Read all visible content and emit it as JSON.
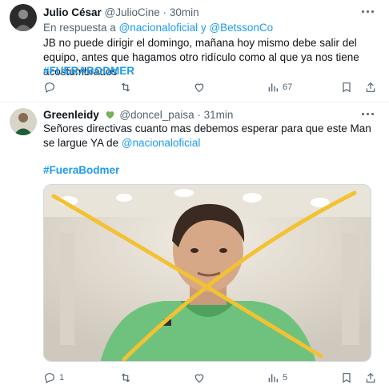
{
  "tweets": [
    {
      "author": "Julio César",
      "handle": "@JulioCine",
      "separator": "·",
      "time": "30min",
      "reply_prefix": "En respuesta a",
      "reply_to_1": "@nacionaloficial",
      "reply_joiner": "y",
      "reply_to_2": "@BetssonCo",
      "text": "JB no puede dirigir el domingo, mañana hoy mismo debe salir del equipo, antes que hagamos otro ridículo como al que ya nos tiene acostumbrados",
      "hashtag": "#FUERABODMER",
      "actions": {
        "reply": "",
        "retweet": "",
        "like": "",
        "views": "67"
      }
    },
    {
      "author": "Greenleidy",
      "handle": "@doncel_paisa",
      "separator": "·",
      "time": "31min",
      "text_before_mention": "Señores directivas cuanto mas debemos esperar para que este Man se largue YA de",
      "mention": "@nacionaloficial",
      "hashtag": "#FueraBodmer",
      "actions": {
        "reply": "1",
        "retweet": "",
        "like": "",
        "views": "5"
      }
    }
  ],
  "icons": {
    "heart": "green-heart-icon",
    "more": "more-icon",
    "reply": "reply-icon",
    "retweet": "retweet-icon",
    "like": "like-icon",
    "views": "views-icon",
    "bookmark": "bookmark-icon",
    "share": "share-icon"
  },
  "colors": {
    "accent": "#1d9bf0",
    "secondary": "#536471",
    "heart": "#78b159",
    "cross": "#f2c232",
    "hoodie": "#6fc27d"
  }
}
